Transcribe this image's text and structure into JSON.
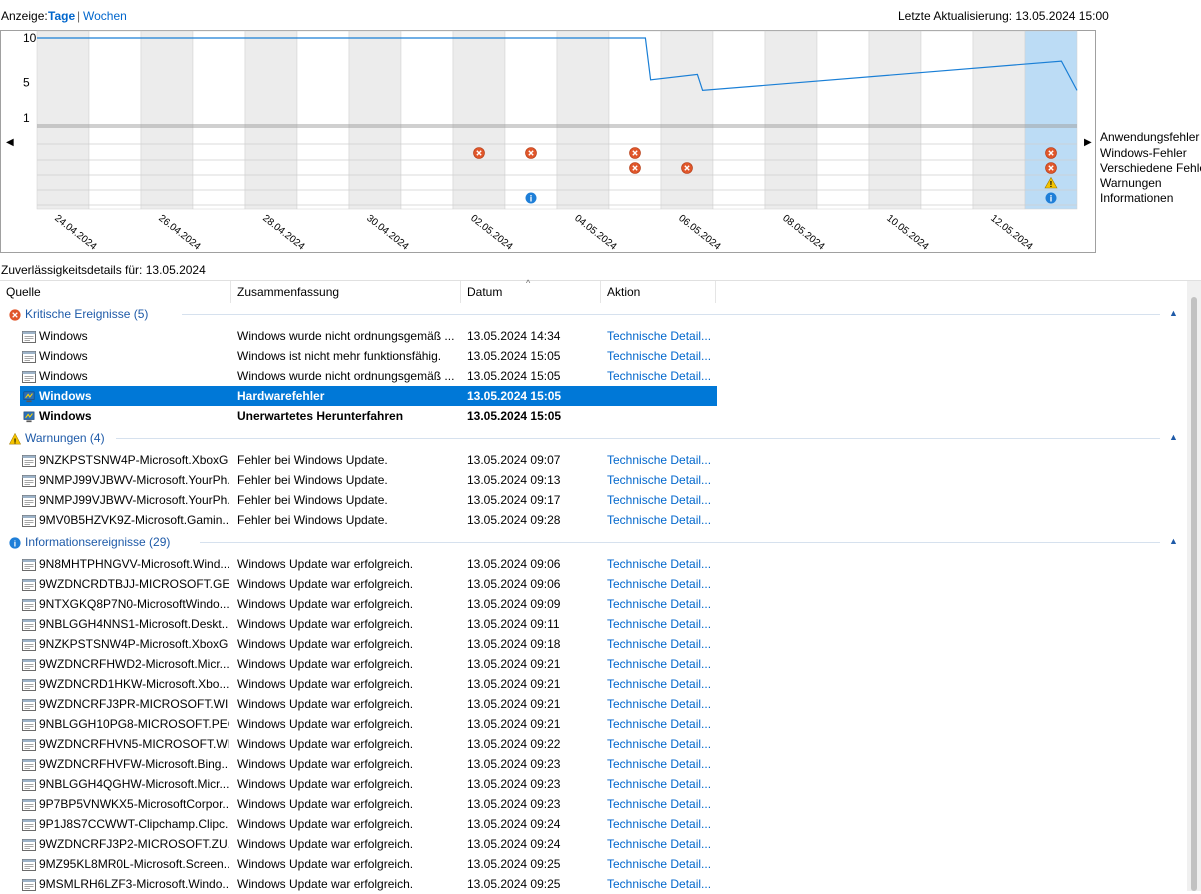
{
  "view": {
    "label": "Anzeige:",
    "days": "Tage",
    "sep": "|",
    "weeks": "Wochen"
  },
  "last_update": "Letzte Aktualisierung: 13.05.2024 15:00",
  "chart_data": {
    "type": "line",
    "y_ticks": [
      "10",
      "5",
      "1"
    ],
    "ylim": [
      1,
      10
    ],
    "index_series": [
      {
        "date": "24.04.2024",
        "value": 10.0
      },
      {
        "date": "05.05.2024",
        "value": 10.0
      },
      {
        "date": "05.05.2024",
        "value": 5.3
      },
      {
        "date": "06.05.2024",
        "value": 5.9
      },
      {
        "date": "06.05.2024",
        "value": 4.1
      },
      {
        "date": "13.05.2024",
        "value": 7.4
      },
      {
        "date": "13.05.2024",
        "value": 4.1
      }
    ],
    "categories": [
      "Anwendungsfehler",
      "Windows-Fehler",
      "Verschiedene Fehler",
      "Warnungen",
      "Informationen"
    ],
    "events": [
      {
        "date": "02.05.2024",
        "category": "Windows-Fehler",
        "kind": "error"
      },
      {
        "date": "03.05.2024",
        "category": "Windows-Fehler",
        "kind": "error"
      },
      {
        "date": "03.05.2024",
        "category": "Informationen",
        "kind": "info"
      },
      {
        "date": "05.05.2024",
        "category": "Windows-Fehler",
        "kind": "error"
      },
      {
        "date": "05.05.2024",
        "category": "Verschiedene Fehler",
        "kind": "error"
      },
      {
        "date": "06.05.2024",
        "category": "Verschiedene Fehler",
        "kind": "error"
      },
      {
        "date": "13.05.2024",
        "category": "Windows-Fehler",
        "kind": "error"
      },
      {
        "date": "13.05.2024",
        "category": "Verschiedene Fehler",
        "kind": "error"
      },
      {
        "date": "13.05.2024",
        "category": "Warnungen",
        "kind": "warning"
      },
      {
        "date": "13.05.2024",
        "category": "Informationen",
        "kind": "info"
      }
    ],
    "x_tick_labels": [
      "24.04.2024",
      "26.04.2024",
      "28.04.2024",
      "30.04.2024",
      "02.05.2024",
      "04.05.2024",
      "06.05.2024",
      "08.05.2024",
      "10.05.2024",
      "12.05.2024"
    ],
    "selected_day": "13.05.2024"
  },
  "details_title": "Zuverlässigkeitsdetails für: 13.05.2024",
  "columns": [
    "Quelle",
    "Zusammenfassung",
    "Datum",
    "Aktion"
  ],
  "groups": [
    {
      "title": "Kritische Ereignisse (5)",
      "icon": "error-icon",
      "rows": [
        {
          "src": "Windows",
          "sum": "Windows wurde nicht ordnungsgemäß ...",
          "date": "13.05.2024 14:34",
          "act": "Technische Detail...",
          "icon": "event-icon"
        },
        {
          "src": "Windows",
          "sum": "Windows ist nicht mehr funktionsfähig.",
          "date": "13.05.2024 15:05",
          "act": "Technische Detail...",
          "icon": "event-icon"
        },
        {
          "src": "Windows",
          "sum": "Windows wurde nicht ordnungsgemäß ...",
          "date": "13.05.2024 15:05",
          "act": "Technische Detail...",
          "icon": "event-icon"
        },
        {
          "src": "Windows",
          "sum": "Hardwarefehler",
          "date": "13.05.2024 15:05",
          "act": "",
          "icon": "monitor-icon",
          "style": "sel"
        },
        {
          "src": "Windows",
          "sum": "Unerwartetes Herunterfahren",
          "date": "13.05.2024 15:05",
          "act": "",
          "icon": "monitor-icon",
          "style": "bold"
        }
      ]
    },
    {
      "title": "Warnungen (4)",
      "icon": "warning-icon",
      "rows": [
        {
          "src": "9NZKPSTSNW4P-Microsoft.XboxG...",
          "sum": "Fehler bei Windows Update.",
          "date": "13.05.2024 09:07",
          "act": "Technische Detail...",
          "icon": "event-icon"
        },
        {
          "src": "9NMPJ99VJBWV-Microsoft.YourPh...",
          "sum": "Fehler bei Windows Update.",
          "date": "13.05.2024 09:13",
          "act": "Technische Detail...",
          "icon": "event-icon"
        },
        {
          "src": "9NMPJ99VJBWV-Microsoft.YourPh...",
          "sum": "Fehler bei Windows Update.",
          "date": "13.05.2024 09:17",
          "act": "Technische Detail...",
          "icon": "event-icon"
        },
        {
          "src": "9MV0B5HZVK9Z-Microsoft.Gamin...",
          "sum": "Fehler bei Windows Update.",
          "date": "13.05.2024 09:28",
          "act": "Technische Detail...",
          "icon": "event-icon"
        }
      ]
    },
    {
      "title": "Informationsereignisse (29)",
      "icon": "info-icon",
      "rows": [
        {
          "src": "9N8MHTPHNGVV-Microsoft.Wind...",
          "sum": "Windows Update war erfolgreich.",
          "date": "13.05.2024 09:06",
          "act": "Technische Detail...",
          "icon": "event-icon"
        },
        {
          "src": "9WZDNCRDTBJJ-MICROSOFT.GET...",
          "sum": "Windows Update war erfolgreich.",
          "date": "13.05.2024 09:06",
          "act": "Technische Detail...",
          "icon": "event-icon"
        },
        {
          "src": "9NTXGKQ8P7N0-MicrosoftWindo...",
          "sum": "Windows Update war erfolgreich.",
          "date": "13.05.2024 09:09",
          "act": "Technische Detail...",
          "icon": "event-icon"
        },
        {
          "src": "9NBLGGH4NNS1-Microsoft.Deskt...",
          "sum": "Windows Update war erfolgreich.",
          "date": "13.05.2024 09:11",
          "act": "Technische Detail...",
          "icon": "event-icon"
        },
        {
          "src": "9NZKPSTSNW4P-Microsoft.XboxG...",
          "sum": "Windows Update war erfolgreich.",
          "date": "13.05.2024 09:18",
          "act": "Technische Detail...",
          "icon": "event-icon"
        },
        {
          "src": "9WZDNCRFHWD2-Microsoft.Micr...",
          "sum": "Windows Update war erfolgreich.",
          "date": "13.05.2024 09:21",
          "act": "Technische Detail...",
          "icon": "event-icon"
        },
        {
          "src": "9WZDNCRD1HKW-Microsoft.Xbo...",
          "sum": "Windows Update war erfolgreich.",
          "date": "13.05.2024 09:21",
          "act": "Technische Detail...",
          "icon": "event-icon"
        },
        {
          "src": "9WZDNCRFJ3PR-MICROSOFT.WI...",
          "sum": "Windows Update war erfolgreich.",
          "date": "13.05.2024 09:21",
          "act": "Technische Detail...",
          "icon": "event-icon"
        },
        {
          "src": "9NBLGGH10PG8-MICROSOFT.PEO...",
          "sum": "Windows Update war erfolgreich.",
          "date": "13.05.2024 09:21",
          "act": "Technische Detail...",
          "icon": "event-icon"
        },
        {
          "src": "9WZDNCRFHVN5-MICROSOFT.WI...",
          "sum": "Windows Update war erfolgreich.",
          "date": "13.05.2024 09:22",
          "act": "Technische Detail...",
          "icon": "event-icon"
        },
        {
          "src": "9WZDNCRFHVFW-Microsoft.Bing...",
          "sum": "Windows Update war erfolgreich.",
          "date": "13.05.2024 09:23",
          "act": "Technische Detail...",
          "icon": "event-icon"
        },
        {
          "src": "9NBLGGH4QGHW-Microsoft.Micr...",
          "sum": "Windows Update war erfolgreich.",
          "date": "13.05.2024 09:23",
          "act": "Technische Detail...",
          "icon": "event-icon"
        },
        {
          "src": "9P7BP5VNWKX5-MicrosoftCorpor...",
          "sum": "Windows Update war erfolgreich.",
          "date": "13.05.2024 09:23",
          "act": "Technische Detail...",
          "icon": "event-icon"
        },
        {
          "src": "9P1J8S7CCWWT-Clipchamp.Clipc...",
          "sum": "Windows Update war erfolgreich.",
          "date": "13.05.2024 09:24",
          "act": "Technische Detail...",
          "icon": "event-icon"
        },
        {
          "src": "9WZDNCRFJ3P2-MICROSOFT.ZU...",
          "sum": "Windows Update war erfolgreich.",
          "date": "13.05.2024 09:24",
          "act": "Technische Detail...",
          "icon": "event-icon"
        },
        {
          "src": "9MZ95KL8MR0L-Microsoft.Screen...",
          "sum": "Windows Update war erfolgreich.",
          "date": "13.05.2024 09:25",
          "act": "Technische Detail...",
          "icon": "event-icon"
        },
        {
          "src": "9MSMLRH6LZF3-Microsoft.Windo...",
          "sum": "Windows Update war erfolgreich.",
          "date": "13.05.2024 09:25",
          "act": "Technische Detail...",
          "icon": "event-icon"
        }
      ]
    }
  ]
}
